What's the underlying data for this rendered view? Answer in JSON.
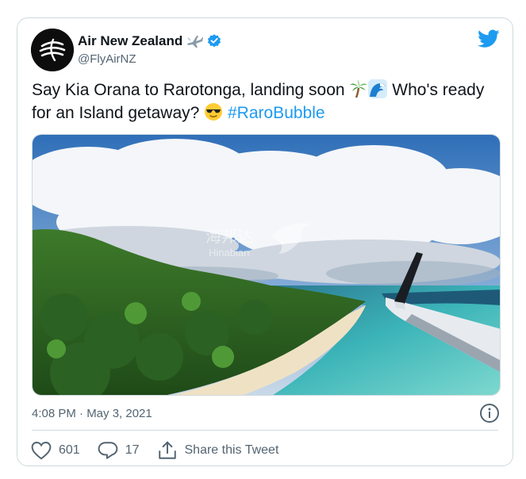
{
  "tweet": {
    "author_name": "Air New Zealand",
    "author_handle": "@FlyAirNZ",
    "text_part1": "Say Kia Orana to Rarotonga, landing soon ",
    "text_part2": " Who's ready for an Island getaway? ",
    "hashtag": "#RaroBubble",
    "emojis": [
      "palm-tree",
      "wave",
      "sunglasses-face"
    ],
    "timestamp": "4:08 PM · May 3, 2021",
    "likes": "601",
    "replies": "17",
    "share_label": "Share this Tweet"
  },
  "media": {
    "watermark_cn": "海邦达",
    "watermark_en": "Hinabian"
  },
  "colors": {
    "accent": "#1d9bf0",
    "text": "#0f1419",
    "secondary": "#536471",
    "border": "#cfd9de"
  }
}
